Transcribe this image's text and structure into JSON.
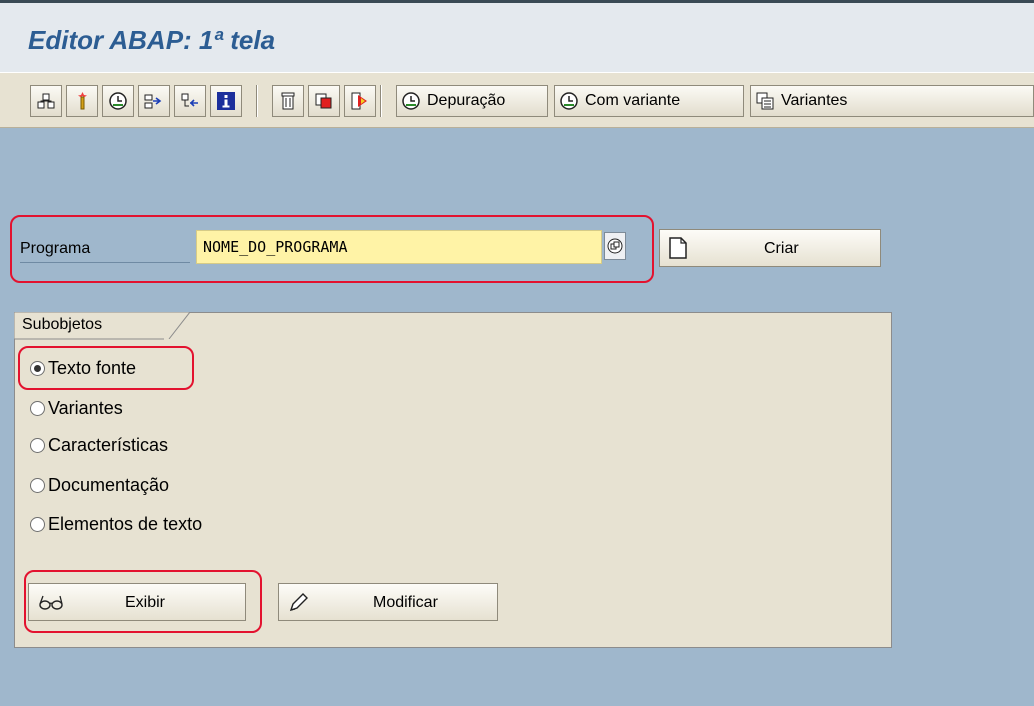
{
  "window": {
    "title": "Editor ABAP: 1ª tela"
  },
  "toolbar": {
    "icons": [
      "object-list-icon",
      "where-used-icon",
      "execute-icon",
      "direct-processing-icon",
      "background-icon",
      "info-icon",
      "delete-icon",
      "copy-icon",
      "rename-icon"
    ],
    "depuracao_label": "Depuração",
    "com_variante_label": "Com variante",
    "variantes_label": "Variantes"
  },
  "program": {
    "label": "Programa",
    "value": "NOME_DO_PROGRAMA",
    "create_label": "Criar"
  },
  "subobjects": {
    "title": "Subobjetos",
    "selected": "Texto fonte",
    "options": [
      "Texto fonte",
      "Variantes",
      "Características",
      "Documentação",
      "Elementos de texto"
    ]
  },
  "actions": {
    "display_label": "Exibir",
    "change_label": "Modificar"
  },
  "colors": {
    "background": "#9fb7cc",
    "title": "#2c5d93",
    "highlight": "#e3122f",
    "input_bg": "#fff3a6"
  }
}
